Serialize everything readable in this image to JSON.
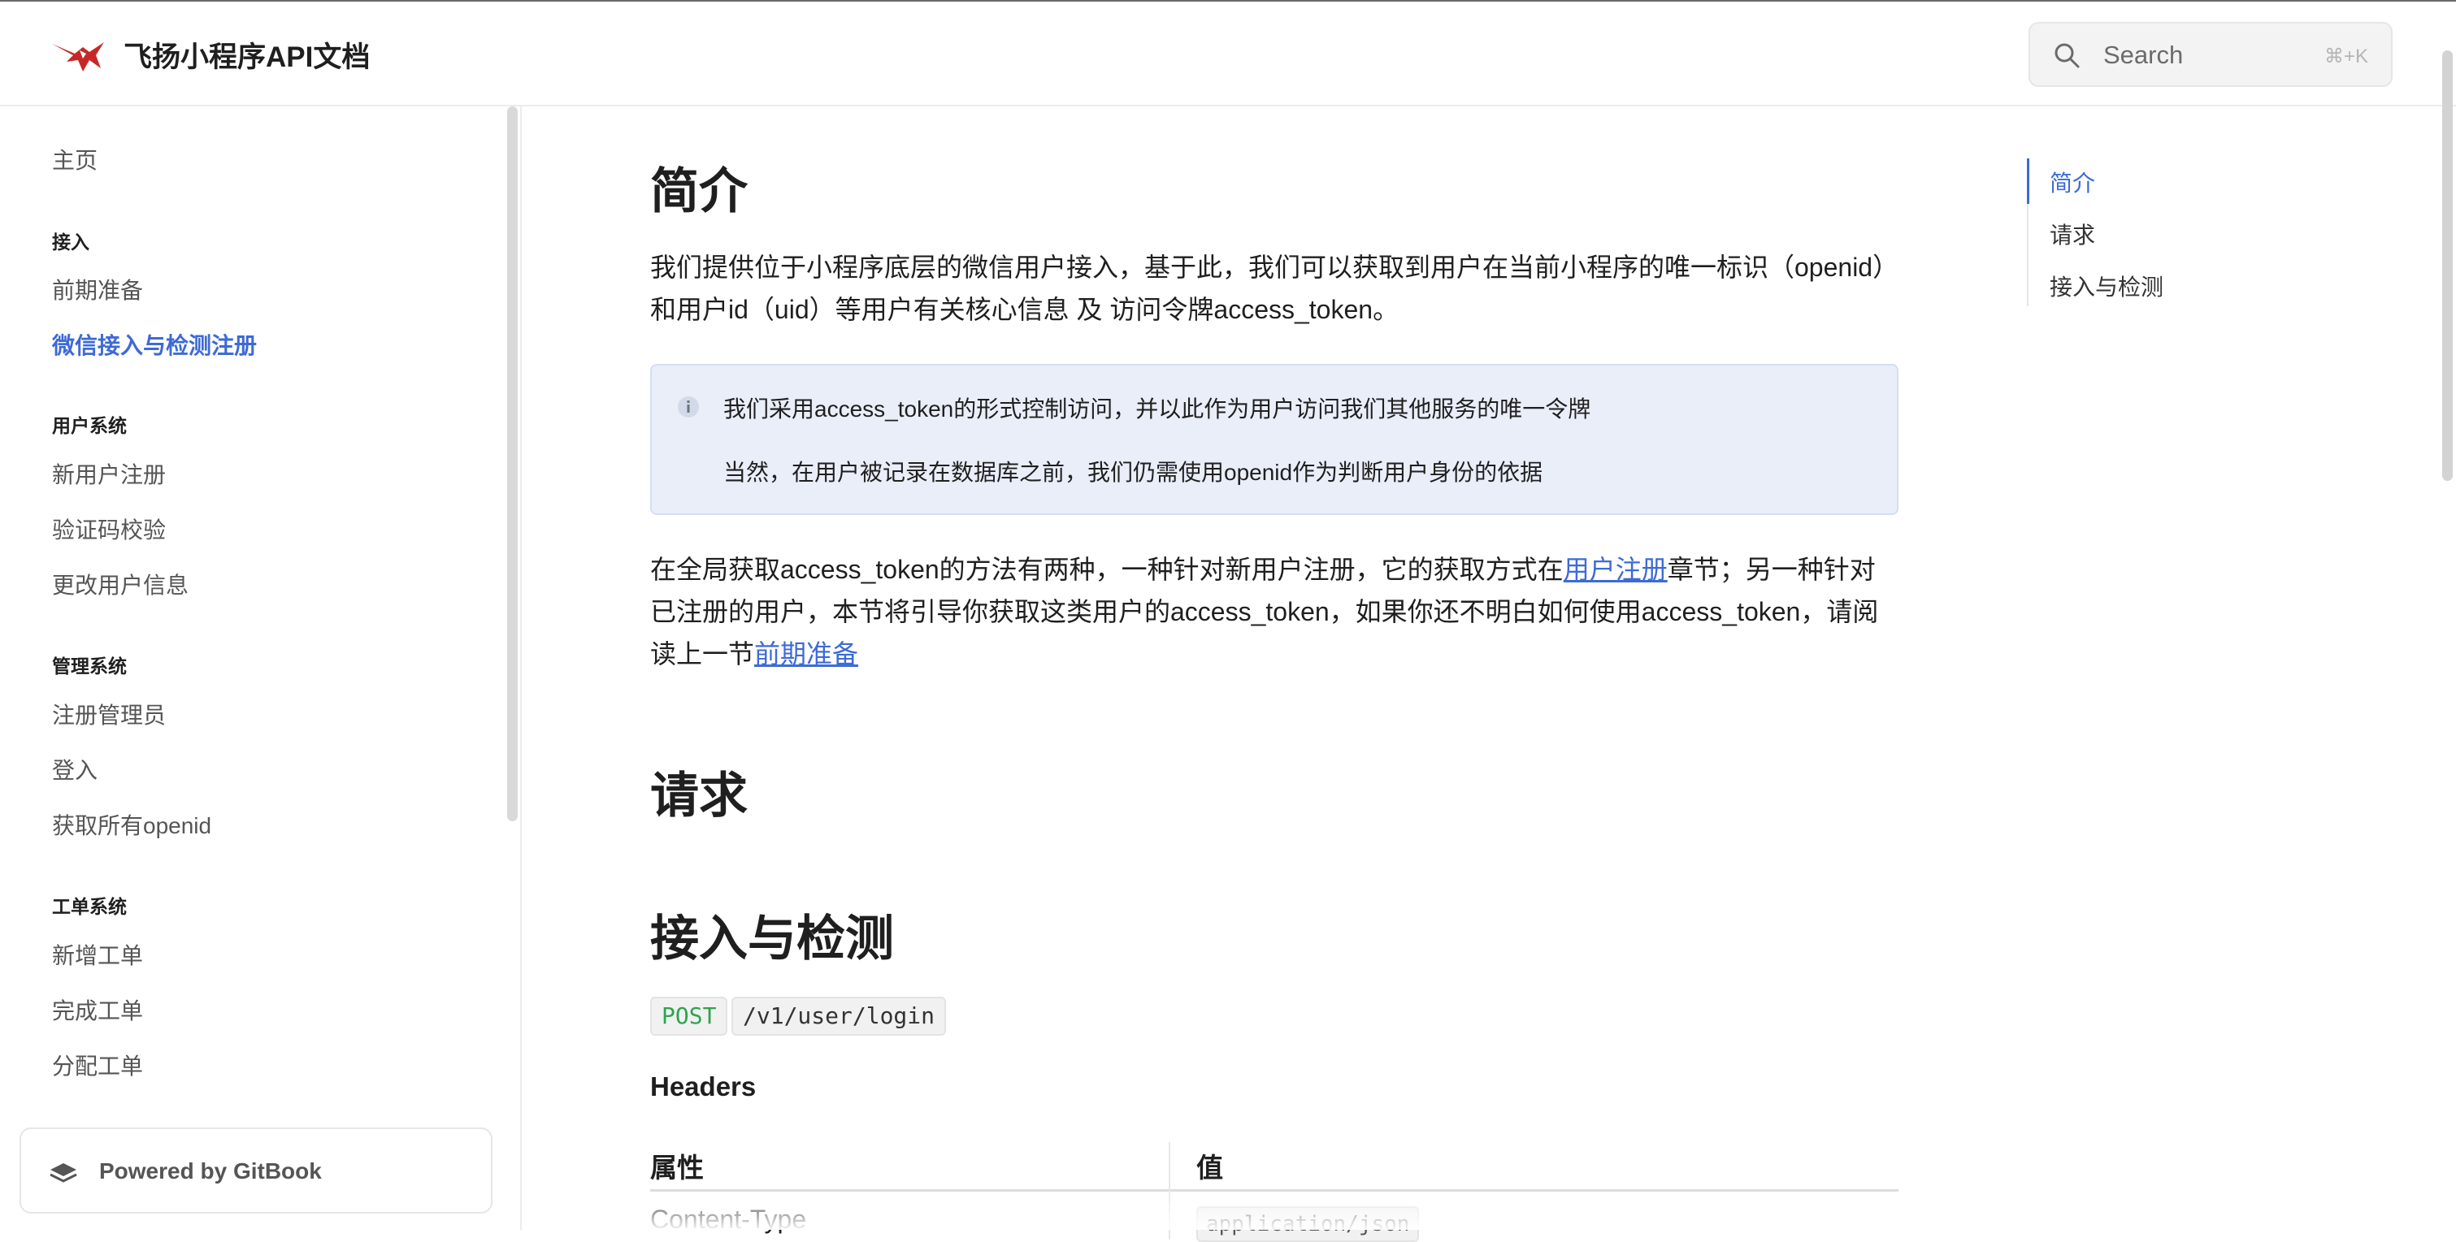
{
  "header": {
    "title": "飞扬小程序API文档",
    "search_placeholder": "Search",
    "search_shortcut": "⌘+K"
  },
  "sidebar": {
    "home": "主页",
    "groups": [
      {
        "title": "接入",
        "items": [
          "前期准备",
          "微信接入与检测注册"
        ]
      },
      {
        "title": "用户系统",
        "items": [
          "新用户注册",
          "验证码校验",
          "更改用户信息"
        ]
      },
      {
        "title": "管理系统",
        "items": [
          "注册管理员",
          "登入",
          "获取所有openid"
        ]
      },
      {
        "title": "工单系统",
        "items": [
          "新增工单",
          "完成工单",
          "分配工单"
        ]
      }
    ],
    "active_item": "微信接入与检测注册",
    "powered_by": "Powered by GitBook"
  },
  "content": {
    "intro_heading": "简介",
    "intro_para": "我们提供位于小程序底层的微信用户接入，基于此，我们可以获取到用户在当前小程序的唯一标识（openid）和用户id（uid）等用户有关核心信息 及 访问令牌access_token。",
    "info_line1": "我们采用access_token的形式控制访问，并以此作为用户访问我们其他服务的唯一令牌",
    "info_line2": "当然，在用户被记录在数据库之前，我们仍需使用openid作为判断用户身份的依据",
    "para2_part1": "在全局获取access_token的方法有两种，一种针对新用户注册，它的获取方式在",
    "para2_link1": "用户注册",
    "para2_part2": "章节；另一种针对已注册的用户，本节将引导你获取这类用户的access_token，如果你还不明白如何使用access_token，请阅读上一节",
    "para2_link2": "前期准备",
    "request_heading": "请求",
    "access_heading": "接入与检测",
    "method": "POST",
    "endpoint": "/v1/user/login",
    "headers_heading": "Headers",
    "table_col1": "属性",
    "table_col2": "值",
    "row1_key": "Content-Type",
    "row1_value": "application/json"
  },
  "toc": {
    "items": [
      "简介",
      "请求",
      "接入与检测"
    ],
    "active": "简介"
  },
  "colors": {
    "accent": "#3d6ad6",
    "method_green": "#2ea44f",
    "info_bg": "#e9eef9",
    "logo_red": "#c62828"
  }
}
